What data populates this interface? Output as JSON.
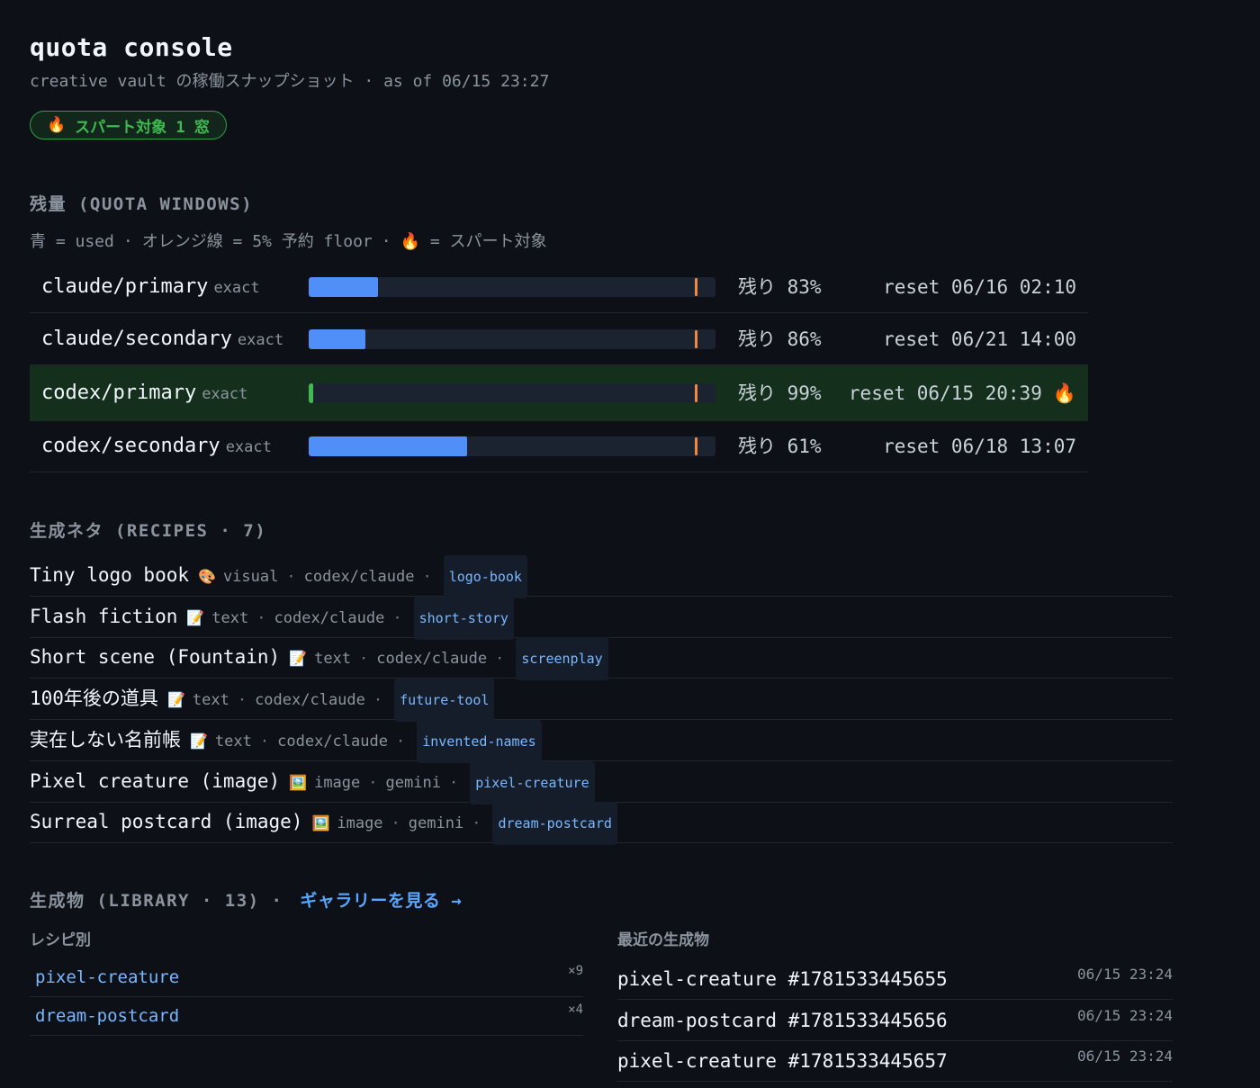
{
  "header": {
    "title": "quota console",
    "subtitle": "creative vault の稼働スナップショット · as of 06/15 23:27",
    "badge": {
      "icon": "fire-icon",
      "emoji": "🔥",
      "label": "スパート対象 1 窓"
    }
  },
  "quota": {
    "heading": "残量 (QUOTA WINDOWS)",
    "legend": {
      "blue": "青 = used",
      "orange": "オレンジ線 = 5% 予約 floor",
      "fire": "🔥 = スパート対象",
      "sep": "·"
    },
    "colors": {
      "used": "#4f8ff7",
      "floor": "#f0883e",
      "highlight": "#14301c"
    },
    "windows": [
      {
        "name": "claude/primary",
        "kind": "exact",
        "used": 0.17,
        "floor": 0.95,
        "remaining": "残り 83%",
        "reset": "reset 06/16 02:10",
        "spurt": false
      },
      {
        "name": "claude/secondary",
        "kind": "exact",
        "used": 0.14,
        "floor": 0.95,
        "remaining": "残り 86%",
        "reset": "reset 06/21 14:00",
        "spurt": false
      },
      {
        "name": "codex/primary",
        "kind": "exact",
        "used": 0.01,
        "floor": 0.95,
        "remaining": "残り 99%",
        "reset": "reset 06/15 20:39",
        "spurt": true,
        "spurt_icon": "🔥"
      },
      {
        "name": "codex/secondary",
        "kind": "exact",
        "used": 0.39,
        "floor": 0.95,
        "remaining": "残り 61%",
        "reset": "reset 06/18 13:07",
        "spurt": false
      }
    ]
  },
  "recipes": {
    "heading": "生成ネタ (RECIPES · 7)",
    "sep": "·",
    "items": [
      {
        "name": "Tiny logo book",
        "icon": "palette-icon",
        "emoji": "🎨",
        "kind": "visual",
        "engine": "codex/claude",
        "tag": "logo-book"
      },
      {
        "name": "Flash fiction",
        "icon": "memo-icon",
        "emoji": "📝",
        "kind": "text",
        "engine": "codex/claude",
        "tag": "short-story"
      },
      {
        "name": "Short scene (Fountain)",
        "icon": "memo-icon",
        "emoji": "📝",
        "kind": "text",
        "engine": "codex/claude",
        "tag": "screenplay"
      },
      {
        "name": "100年後の道具",
        "icon": "memo-icon",
        "emoji": "📝",
        "kind": "text",
        "engine": "codex/claude",
        "tag": "future-tool"
      },
      {
        "name": "実在しない名前帳",
        "icon": "memo-icon",
        "emoji": "📝",
        "kind": "text",
        "engine": "codex/claude",
        "tag": "invented-names"
      },
      {
        "name": "Pixel creature (image)",
        "icon": "picture-icon",
        "emoji": "🖼️",
        "kind": "image",
        "engine": "gemini",
        "tag": "pixel-creature"
      },
      {
        "name": "Surreal postcard (image)",
        "icon": "picture-icon",
        "emoji": "🖼️",
        "kind": "image",
        "engine": "gemini",
        "tag": "dream-postcard"
      }
    ]
  },
  "library": {
    "heading": "生成物 (LIBRARY · 13) ·",
    "gallery_link": "ギャラリーを見る →",
    "by_recipe_heading": "レシピ別",
    "recent_heading": "最近の生成物",
    "by_recipe": [
      {
        "name": "pixel-creature",
        "count": "×9"
      },
      {
        "name": "dream-postcard",
        "count": "×4"
      }
    ],
    "recent": [
      {
        "name": "pixel-creature #1781533445655",
        "time": "06/15 23:24"
      },
      {
        "name": "dream-postcard #1781533445656",
        "time": "06/15 23:24"
      },
      {
        "name": "pixel-creature #1781533445657",
        "time": "06/15 23:24"
      }
    ]
  }
}
